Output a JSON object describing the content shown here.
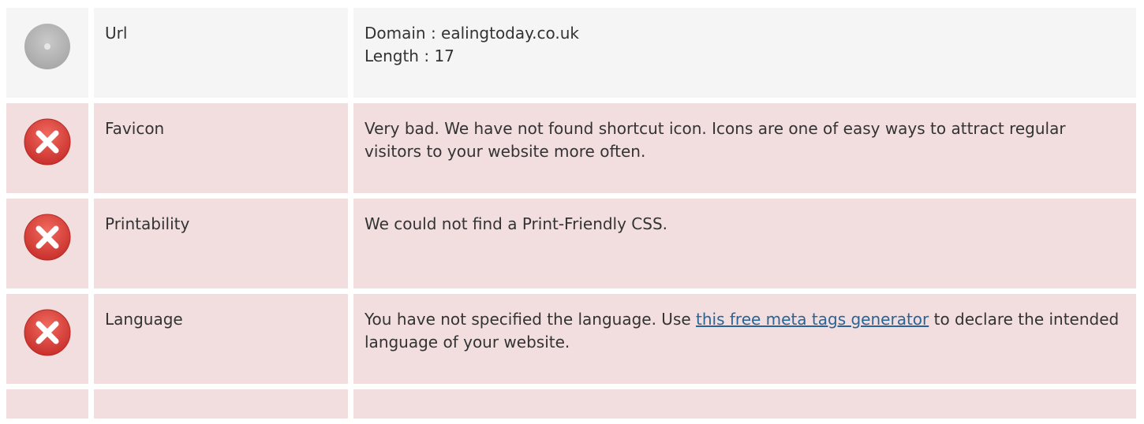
{
  "rows": [
    {
      "status": "neutral",
      "icon": "neutral-circle-icon",
      "label": "Url",
      "lines": [
        "Domain : ealingtoday.co.uk",
        "Length : 17"
      ]
    },
    {
      "status": "bad",
      "icon": "error-x-icon",
      "label": "Favicon",
      "text": "Very bad. We have not found shortcut icon. Icons are one of easy ways to attract regular visitors to your website more often."
    },
    {
      "status": "bad",
      "icon": "error-x-icon",
      "label": "Printability",
      "text": "We could not find a Print-Friendly CSS."
    },
    {
      "status": "bad",
      "icon": "error-x-icon",
      "label": "Language",
      "text_before": "You have not specified the language. Use ",
      "link_text": "this free meta tags generator",
      "text_after": " to declare the intended language of your website."
    }
  ],
  "colors": {
    "neutral_bg": "#f5f5f5",
    "bad_bg": "#f2dede",
    "error_red": "#d9413a",
    "link": "#2a6496"
  }
}
